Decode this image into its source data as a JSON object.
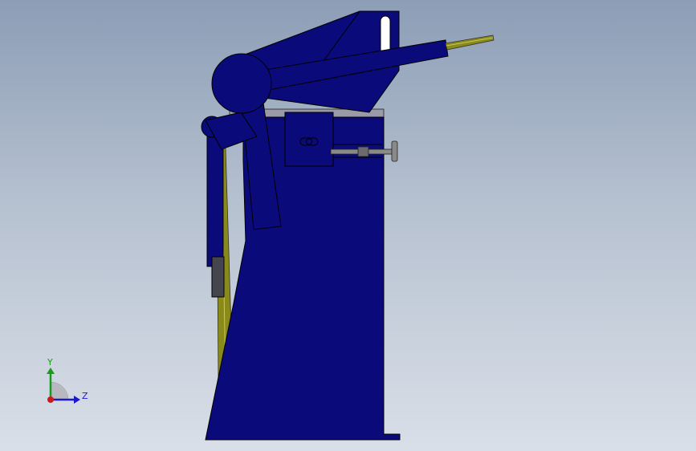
{
  "viewport": {
    "background_top": "#8c9db6",
    "background_bottom": "#d9dfe8",
    "model_color": "#0a0a7a",
    "rod_color": "#8a8a1a",
    "steel_color": "#8a8a8a"
  },
  "triad": {
    "y_label": "Y",
    "z_label": "Z",
    "y_color": "#1a9a1a",
    "z_color": "#1a1acc",
    "x_color": "#cc1a1a"
  }
}
